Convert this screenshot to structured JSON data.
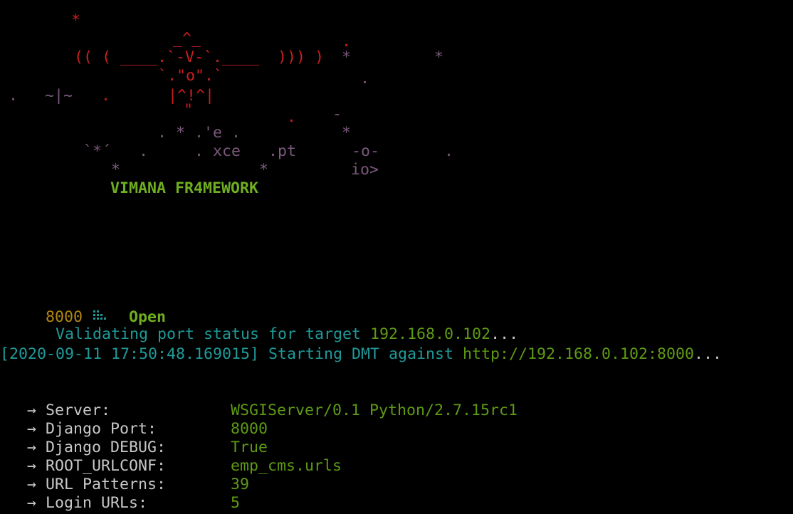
{
  "banner": {
    "line1": "    *",
    "line2a": "         _^_",
    "line2b": "        .",
    "line3a": "    (( ( ____.`-V-`.____  ))) ) ",
    "line3b": " *         *",
    "line4a": "         `.\"o\".`",
    "line4b": "           .",
    "line5a": ".  ~|~  .     |^!^|",
    "line6a": "               \"",
    "line6b": "    .    -",
    "line7a": "        . * .'e .",
    "line7b": "         *",
    "line8a": "   `*´   .     . xce   .pt      -o-       .",
    "line9a": "      *               *         io>",
    "title": "VIMANA FR4MEWORK"
  },
  "scan": {
    "icon": "dots-icon",
    "prefix": "Validating port status for target ",
    "target": "192.168.0.102",
    "ellipsis": "...",
    "port": "8000",
    "state": "Open"
  },
  "dmt": {
    "timestamp": "[2020-09-11 17:50:48.169015]",
    "text": " Starting DMT against ",
    "url": "http://192.168.0.102:8000",
    "ellipsis": "..."
  },
  "results": [
    {
      "label": "Server:",
      "value": "WSGIServer/0.1 Python/2.7.15rc1"
    },
    {
      "label": "Django Port:",
      "value": "8000"
    },
    {
      "label": "Django DEBUG:",
      "value": "True"
    },
    {
      "label": "ROOT_URLCONF:",
      "value": "emp_cms.urls"
    },
    {
      "label": "URL Patterns:",
      "value": "39"
    },
    {
      "label": "Login URLs:",
      "value": "5"
    }
  ],
  "arrow": "→",
  "colors": {
    "background": "#000000",
    "red": "#cc1f1f",
    "purple": "#7b587c",
    "teal": "#1f9a99",
    "green": "#5e9a14",
    "orange": "#b2860e"
  }
}
